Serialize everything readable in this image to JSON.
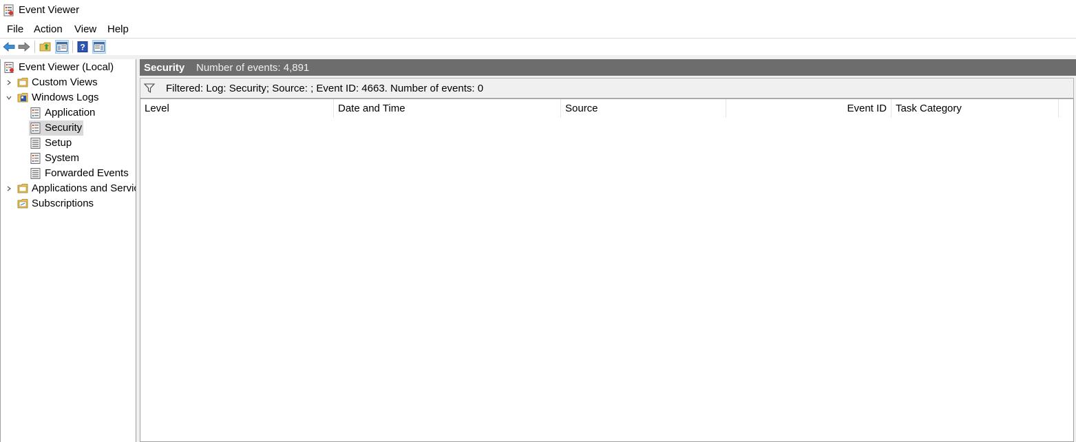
{
  "window": {
    "title": "Event Viewer"
  },
  "menu": {
    "items": [
      "File",
      "Action",
      "View",
      "Help"
    ]
  },
  "toolbar": {
    "buttons": [
      "back-arrow-icon",
      "forward-arrow-icon",
      "folder-up-icon",
      "show-hide-console-tree-icon",
      "help-icon",
      "show-hide-action-pane-icon"
    ]
  },
  "tree": {
    "root": "Event Viewer (Local)",
    "custom_views": "Custom Views",
    "windows_logs": "Windows Logs",
    "application": "Application",
    "security": "Security",
    "setup": "Setup",
    "system": "System",
    "forwarded_events": "Forwarded Events",
    "apps_services": "Applications and Services Logs",
    "subscriptions": "Subscriptions"
  },
  "header": {
    "title": "Security",
    "count": "Number of events: 4,891"
  },
  "filter": {
    "text": "Filtered: Log: Security; Source: ; Event ID: 4663. Number of events: 0"
  },
  "columns": [
    "Level",
    "Date and Time",
    "Source",
    "Event ID",
    "Task Category"
  ],
  "rows": [],
  "colors": {
    "header_bg": "#6d6d6d",
    "selected_bg": "#d9d9d9",
    "active_button_bg": "#cce4f7",
    "back_arrow": "#3b8fd9"
  }
}
